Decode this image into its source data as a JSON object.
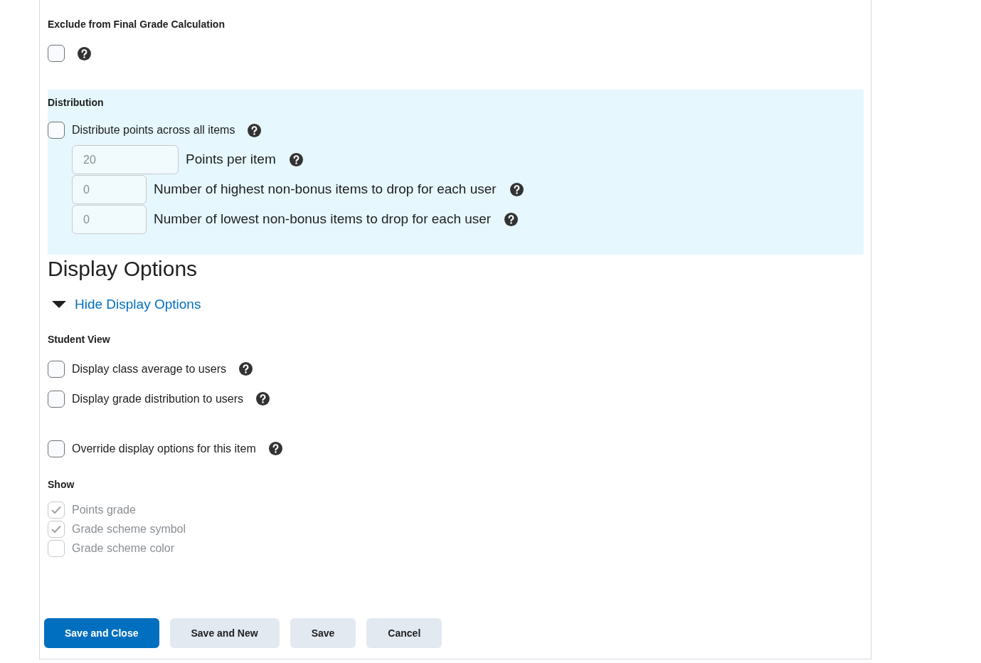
{
  "exclude": {
    "heading": "Exclude from Final Grade Calculation",
    "checked": false
  },
  "distribution": {
    "heading": "Distribution",
    "option": {
      "label": "Distribute points across all items",
      "checked": false
    },
    "fields": [
      {
        "value": "20",
        "label": "Points per item",
        "disabled": true
      },
      {
        "value": "0",
        "label": "Number of highest non-bonus items to drop for each user",
        "disabled": true
      },
      {
        "value": "0",
        "label": "Number of lowest non-bonus items to drop for each user",
        "disabled": true
      }
    ]
  },
  "display_options": {
    "title": "Display Options",
    "toggle": {
      "label": "Hide Display Options",
      "expanded": true
    },
    "student_view": {
      "heading": "Student View",
      "options": [
        {
          "label": "Display class average to users",
          "checked": false
        },
        {
          "label": "Display grade distribution to users",
          "checked": false
        }
      ]
    },
    "override": {
      "label": "Override display options for this item",
      "checked": false
    },
    "show": {
      "heading": "Show",
      "options": [
        {
          "label": "Points grade",
          "checked": true,
          "disabled": true
        },
        {
          "label": "Grade scheme symbol",
          "checked": true,
          "disabled": true
        },
        {
          "label": "Grade scheme color",
          "checked": false,
          "disabled": true
        }
      ]
    }
  },
  "buttons": [
    {
      "label": "Save and Close",
      "kind": "primary"
    },
    {
      "label": "Save and New",
      "kind": "secondary"
    },
    {
      "label": "Save",
      "kind": "secondary"
    },
    {
      "label": "Cancel",
      "kind": "secondary"
    }
  ]
}
